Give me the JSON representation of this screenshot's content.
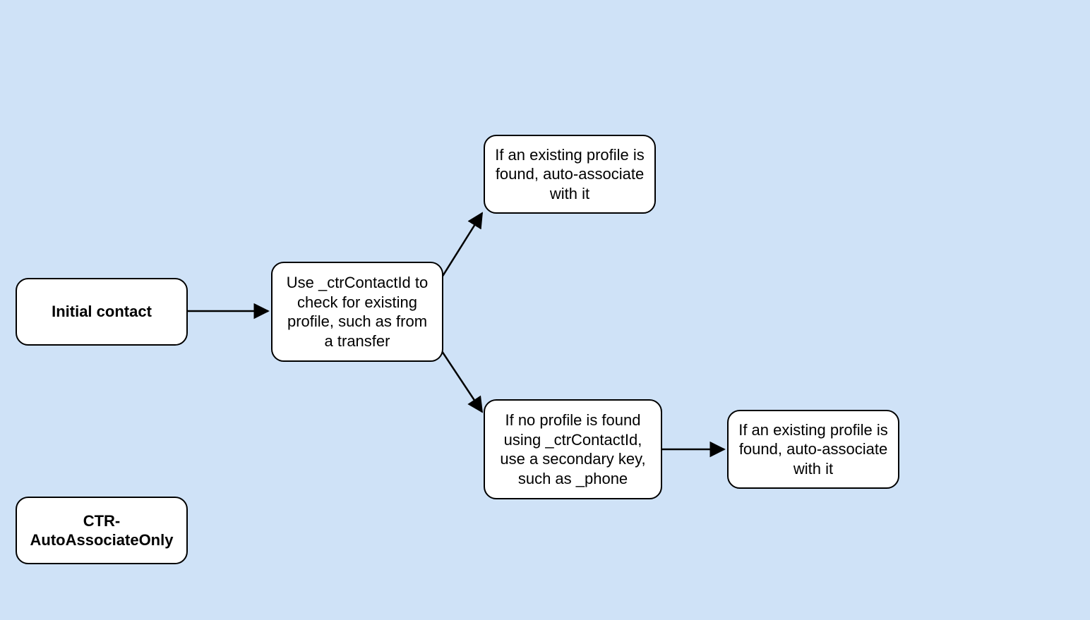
{
  "nodes": {
    "initial_contact": {
      "label": "Initial contact"
    },
    "check_profile": {
      "label": "Use _ctrContactId to check for existing profile, such as from a transfer"
    },
    "found_top": {
      "label": "If an existing profile is found, auto-associate with it"
    },
    "no_profile": {
      "label": "If no profile is found using _ctrContactId, use a secondary key, such as _phone"
    },
    "found_right": {
      "label": "If an existing profile is found, auto-associate with it"
    },
    "ctr_box": {
      "label": "CTR-AutoAssociateOnly"
    }
  }
}
